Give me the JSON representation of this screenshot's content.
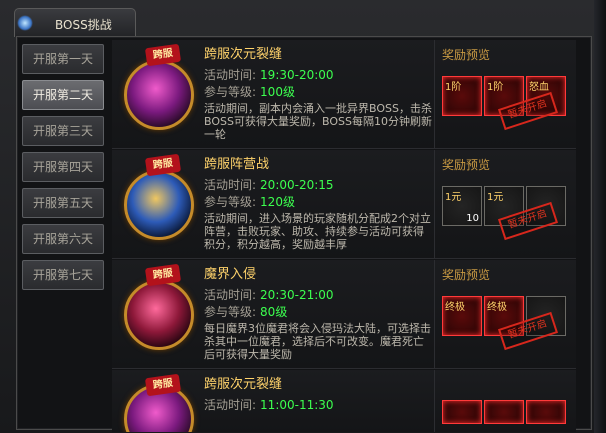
{
  "window": {
    "title": "BOSS挑战"
  },
  "days": [
    {
      "label": "开服第一天",
      "active": false
    },
    {
      "label": "开服第二天",
      "active": true
    },
    {
      "label": "开服第三天",
      "active": false
    },
    {
      "label": "开服第四天",
      "active": false
    },
    {
      "label": "开服第五天",
      "active": false
    },
    {
      "label": "开服第六天",
      "active": false
    },
    {
      "label": "开服第七天",
      "active": false
    }
  ],
  "labels": {
    "time": "活动时间:",
    "level": "参与等级:",
    "reward_preview": "奖励预览",
    "not_open": "暂未开启",
    "boss_badge": "跨服"
  },
  "events": [
    {
      "name": "跨服次元裂缝",
      "time": "19:30-20:00",
      "level": "100级",
      "desc": "活动期间，副本内会涌入一批异界BOSS，击杀BOSS可获得大量奖励，BOSS每隔10分钟刷新一轮",
      "rewards": [
        {
          "tag": "1阶",
          "count": ""
        },
        {
          "tag": "1阶",
          "count": ""
        },
        {
          "tag": "怒血",
          "count": ""
        }
      ]
    },
    {
      "name": "跨服阵营战",
      "time": "20:00-20:15",
      "level": "120级",
      "desc": "活动期间，进入场景的玩家随机分配成2个对立阵营，击败玩家、助攻、持续参与活动可获得积分，积分越高，奖励越丰厚",
      "rewards": [
        {
          "tag": "1元",
          "count": "10"
        },
        {
          "tag": "1元",
          "count": ""
        },
        {
          "tag": "",
          "count": ""
        }
      ]
    },
    {
      "name": "魔界入侵",
      "time": "20:30-21:00",
      "level": "80级",
      "desc": "每日魔界3位魔君将会入侵玛法大陆，可选择击杀其中一位魔君，选择后不可改变。魔君死亡后可获得大量奖励",
      "rewards": [
        {
          "tag": "终极",
          "count": ""
        },
        {
          "tag": "终极",
          "count": ""
        },
        {
          "tag": "",
          "count": ""
        }
      ]
    },
    {
      "name": "跨服次元裂缝",
      "time": "11:00-11:30",
      "level": "",
      "desc": "",
      "rewards": []
    }
  ]
}
